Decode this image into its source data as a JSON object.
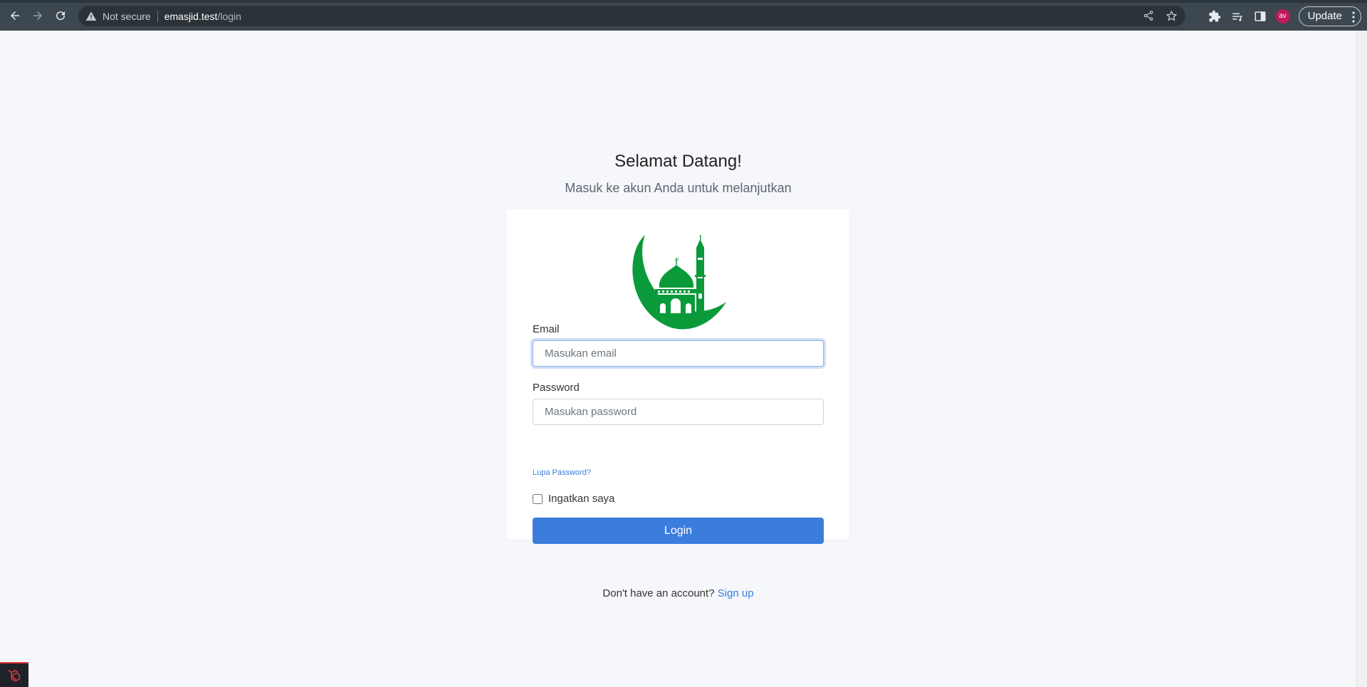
{
  "browser": {
    "security_label": "Not secure",
    "url_host": "emasjid.test",
    "url_path": "/login",
    "update_label": "Update",
    "avatar_initials": "av"
  },
  "page": {
    "title": "Selamat Datang!",
    "subtitle": "Masuk ke akun Anda untuk melanjutkan"
  },
  "form": {
    "email_label": "Email",
    "email_placeholder": "Masukan email",
    "email_value": "",
    "password_label": "Password",
    "password_placeholder": "Masukan password",
    "password_value": "",
    "forgot_link": "Lupa Password?",
    "remember_label": "Ingatkan saya",
    "remember_checked": false,
    "login_button": "Login"
  },
  "footer": {
    "prompt": "Don't have an account?",
    "signup_link": "Sign up"
  },
  "colors": {
    "accent": "#3b7ddd",
    "logo_green": "#0a9a3a",
    "page_bg": "#f5f7fb",
    "avatar_bg": "#c2185b"
  },
  "icons": [
    "back-arrow-icon",
    "forward-arrow-icon",
    "reload-icon",
    "warning-icon",
    "share-icon",
    "star-icon",
    "extensions-icon",
    "reading-list-icon",
    "side-panel-icon",
    "kebab-menu-icon",
    "mosque-logo",
    "laravel-icon"
  ]
}
